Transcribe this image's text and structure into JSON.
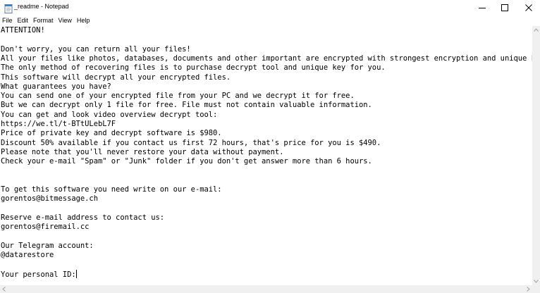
{
  "window": {
    "title": "_readme - Notepad",
    "icon": "notepad-icon",
    "controls": [
      "minimize-icon",
      "maximize-icon",
      "close-icon"
    ]
  },
  "menu": {
    "items": [
      "File",
      "Edit",
      "Format",
      "View",
      "Help"
    ]
  },
  "document": {
    "lines": [
      "ATTENTION!",
      "",
      "Don't worry, you can return all your files!",
      "All your files like photos, databases, documents and other important are encrypted with strongest encryption and unique key.",
      "The only method of recovering files is to purchase decrypt tool and unique key for you.",
      "This software will decrypt all your encrypted files.",
      "What guarantees you have?",
      "You can send one of your encrypted file from your PC and we decrypt it for free.",
      "But we can decrypt only 1 file for free. File must not contain valuable information.",
      "You can get and look video overview decrypt tool:",
      "https://we.tl/t-BTtULebL7F",
      "Price of private key and decrypt software is $980.",
      "Discount 50% available if you contact us first 72 hours, that's price for you is $490.",
      "Please note that you'll never restore your data without payment.",
      "Check your e-mail \"Spam\" or \"Junk\" folder if you don't get answer more than 6 hours.",
      "",
      "",
      "To get this software you need write on our e-mail:",
      "gorentos@bitmessage.ch",
      "",
      "Reserve e-mail address to contact us:",
      "gorentos@firemail.cc",
      "",
      "Our Telegram account:",
      "@datarestore",
      "",
      "Your personal ID:"
    ]
  }
}
